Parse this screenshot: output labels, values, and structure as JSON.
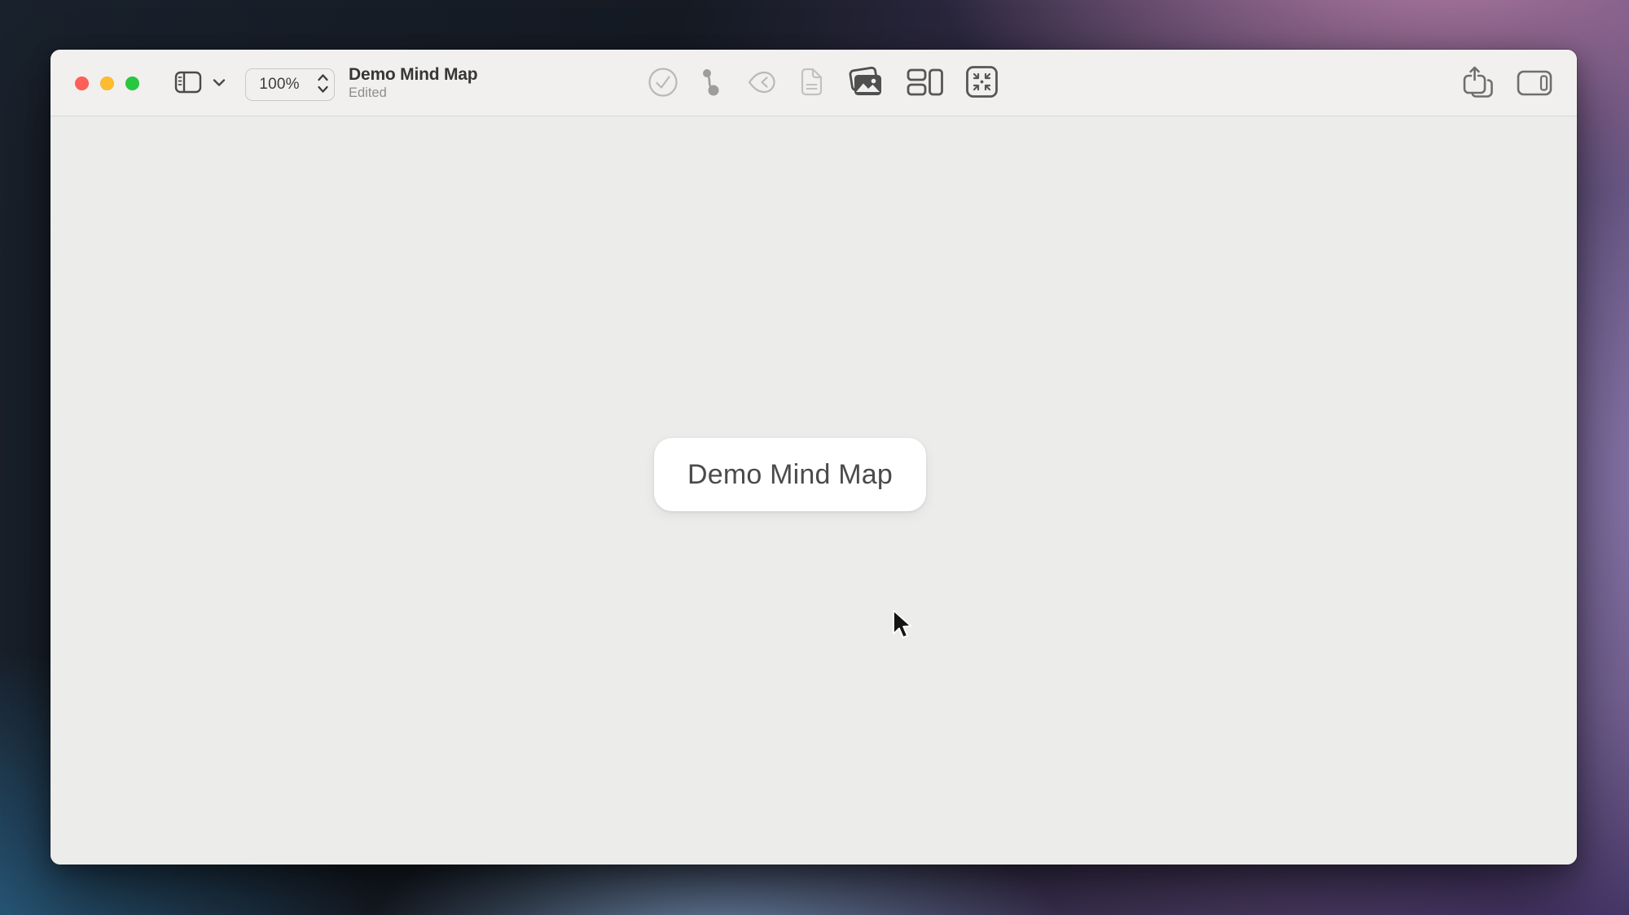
{
  "window": {
    "controls": {
      "close_color": "#ff5f57",
      "minimize_color": "#febc2e",
      "zoom_color": "#28c740"
    },
    "titlebar": {
      "zoom_value": "100%",
      "title": "Demo Mind Map",
      "subtitle": "Edited",
      "left_icons": [
        "sidebar-toggle-icon",
        "chevron-down-icon",
        "zoom-stepper-icon"
      ],
      "center_icons": [
        "task-checkmark-icon",
        "node-connection-icon",
        "focus-back-icon",
        "note-document-icon",
        "media-library-icon",
        "layout-arrange-icon",
        "fit-to-view-icon"
      ],
      "right_icons": [
        "share-icon",
        "inspector-panel-icon"
      ]
    }
  },
  "canvas": {
    "root_node": {
      "label": "Demo Mind Map"
    }
  },
  "colors": {
    "titlebar_bg": "#f1f0ef",
    "canvas_bg": "#ececeb",
    "node_bg": "#ffffff",
    "node_text": "#4b4b4b",
    "icon_enabled": "#4f4f4f",
    "icon_disabled": "#b9b8b7",
    "icon_mid": "#9e9d9c",
    "icon_secondary": "#6e6e6e"
  }
}
